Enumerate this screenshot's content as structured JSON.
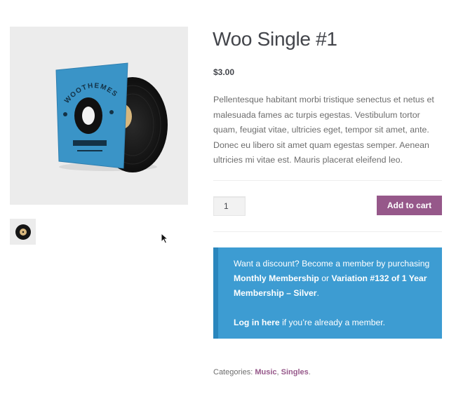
{
  "product": {
    "title": "Woo Single #1",
    "price": "$3.00",
    "description": "Pellentesque habitant morbi tristique senectus et netus et malesuada fames ac turpis egestas. Vestibulum tortor quam, feugiat vitae, ultricies eget, tempor sit amet, ante. Donec eu libero sit amet quam egestas semper. Aenean ultricies mi vitae est. Mauris placerat eleifend leo.",
    "quantity": "1",
    "add_to_cart_label": "Add to cart"
  },
  "gallery": {
    "sleeve_brand_text": "WOOTHEMES",
    "main_image_icon": "vinyl-record-icon",
    "thumbnail_icon": "vinyl-record-icon"
  },
  "membership_notice": {
    "intro": "Want a discount? Become a member by purchasing ",
    "plan_1": "Monthly Membership",
    "or_text": " or ",
    "plan_2": "Variation #132 of 1 Year Membership – Silver",
    "period": ".",
    "login_link": "Log in here",
    "login_suffix": " if you’re already a member."
  },
  "meta": {
    "categories_label": "Categories: ",
    "categories": [
      "Music",
      "Singles"
    ],
    "separator": ", ",
    "end": "."
  },
  "colors": {
    "accent": "#96588a",
    "notice_bg": "#3d9cd2",
    "text": "#43454b"
  }
}
